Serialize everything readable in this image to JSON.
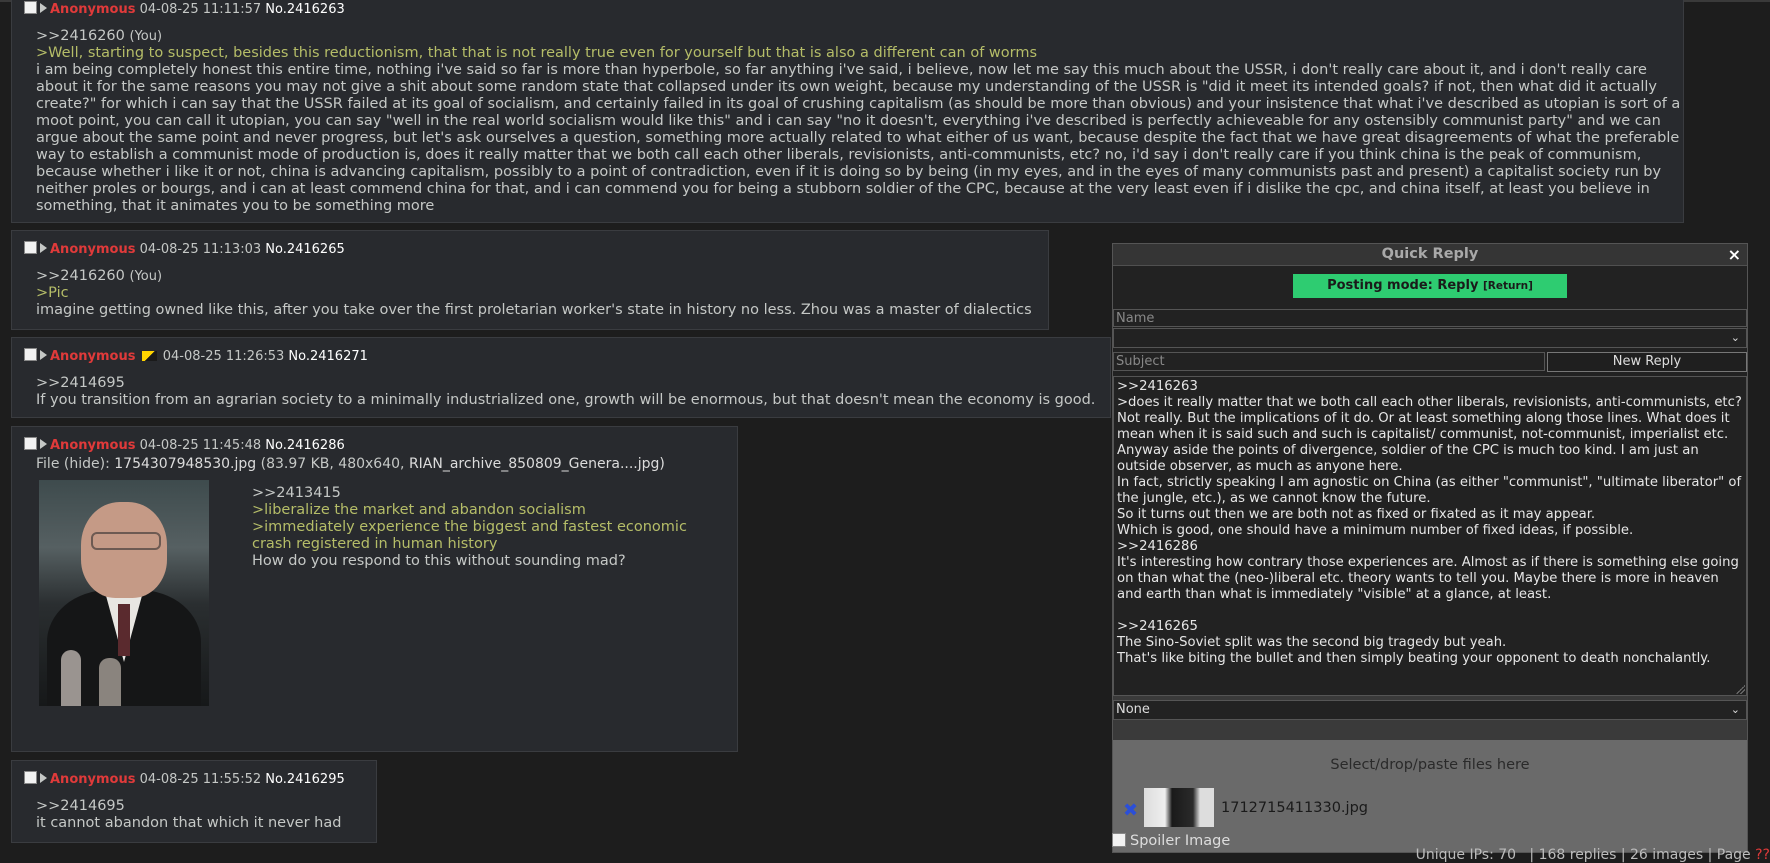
{
  "posts": [
    {
      "name": "Anonymous",
      "date": "04-08-25 11:11:57",
      "no": "No.2416263",
      "reply_to": ">>2416260",
      "you": "(You)",
      "greentext": [
        ">Well, starting to suspect, besides this reductionism, that that is not really true even for yourself but that is also a different can of worms"
      ],
      "lines": [
        "i am being completely honest this entire time, nothing i've said so far is more than hyperbole, so far anything i've said, i believe, now let me say this much about the USSR, i don't really care about it, and i don't really care",
        "about it for the same reasons you may not give a shit about some random state that collapsed under its own weight, because my understanding of the USSR is \"did it meet its intended goals? if not, then what did it actually",
        "create?\" for which i can say that the USSR failed at its goal of socialism, and certainly failed in its goal of crushing capitalism (as should be more than obvious) and your insistence that what i've described as utopian is sort of a",
        "moot point, you can call it utopian, you can say \"well in the real world socialism would like this\" and i can say \"no it doesn't, everything i've described is perfectly achieveable for any ostensibly communist party\" and we can",
        "argue about the same point and never progress, but let's ask ourselves a question, something more actually related to what either of us want, because despite the fact that we have great disagreements of what the preferable",
        "way to establish a communist mode of production is, does it really matter that we both call each other liberals, revisionists, anti-communists, etc? no, i'd say i don't really care if you think china is the peak of communism,",
        "because whether i like it or not, china is advancing capitalism, possibly to a point of contradiction, even if it is doing so by being (in my eyes, and in the eyes of many communists past and present) a capitalist society run by",
        "neither proles or bourgs, and i can at least commend china for that, and i can commend you for being a stubborn soldier of the CPC, because at the very least even if i dislike the cpc, and china itself, at least you believe in",
        "something, that it animates you to be something more"
      ]
    },
    {
      "name": "Anonymous",
      "date": "04-08-25 11:13:03",
      "no": "No.2416265",
      "reply_to": ">>2416260",
      "you": "(You)",
      "greentext": [
        ">Pic"
      ],
      "lines": [
        "imagine getting owned like this, after you take over the first proletarian worker's state in history no less. Zhou was a master of dialectics"
      ]
    },
    {
      "name": "Anonymous",
      "date": "04-08-25 11:26:53",
      "no": "No.2416271",
      "reply_to": ">>2414695",
      "lines": [
        "If you transition from an agrarian society to a minimally industrialized one, growth will be enormous, but that doesn't mean the economy is good."
      ]
    },
    {
      "name": "Anonymous",
      "date": "04-08-25 11:45:48",
      "no": "No.2416286",
      "file_label": "File (",
      "file_hide": "hide",
      "file_after": "):",
      "file_name": "1754307948530.jpg",
      "file_meta": "(83.97 KB, 480x640,",
      "file_orig": "RIAN_archive_850809_Genera....jpg)",
      "reply_to": ">>2413415",
      "greentext": [
        ">liberalize the market and abandon socialism",
        ">immediately experience the biggest and fastest economic",
        "crash registered in human history"
      ],
      "lines": [
        "How do you respond to this without sounding mad?"
      ]
    },
    {
      "name": "Anonymous",
      "date": "04-08-25 11:55:52",
      "no": "No.2416295",
      "reply_to": ">>2414695",
      "lines": [
        "it cannot abandon that which it never had"
      ]
    }
  ],
  "quick_reply": {
    "title": "Quick Reply",
    "close": "×",
    "mode": "Posting mode: Reply",
    "mode_return": "[Return]",
    "name_placeholder": "Name",
    "subject_placeholder": "Subject",
    "new_reply": "New Reply",
    "select_value": "None",
    "textarea_lines": [
      ">>2416263",
      ">does it really matter that we both call each other liberals, revisionists, anti-communists, etc?",
      "Not really. But the implications of it do. Or at least something along those lines. What does it",
      "mean when it is said such and such is capitalist/ communist, not-communist, imperialist etc.",
      "Anyway aside the points of divergence, soldier of the CPC is much too kind. I am just an",
      "outside observer, as much as anyone here.",
      "In fact, strictly speaking I am agnostic on China (as either \"communist\", \"ultimate liberator\" of",
      "the jungle, etc.), as we cannot know the future.",
      "So it turns out then we are both not as fixed or fixated as it may appear.",
      "Which is good, one should have a minimum number of fixed ideas, if possible.",
      ">>2416286",
      "It's interesting how contrary those experiences are. Almost as if there is something else going",
      "on than what the (neo-)liberal etc. theory wants to tell you. Maybe there is more in heaven",
      "and earth than what is immediately \"visible\" at a glance, at least.",
      "",
      ">>2416265",
      "The Sino-Soviet split was the second big tragedy but yeah.",
      "That's like biting the bullet and then simply beating your opponent to death nonchalantly."
    ],
    "drop_hint": "Select/drop/paste files here",
    "attached_file": "1712715411330.jpg",
    "spoiler": "Spoiler Image"
  },
  "thread_stats": {
    "text": "Unique IPs: 70   | 168 replies | 26 images | Page ",
    "page": "??"
  }
}
